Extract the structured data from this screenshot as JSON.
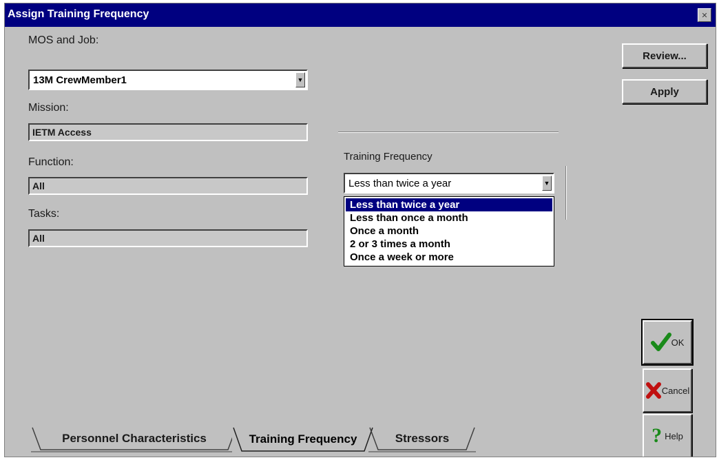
{
  "window": {
    "title": "Assign Training Frequency"
  },
  "mos_job": {
    "label": "MOS and Job:",
    "value": "13M CrewMember1"
  },
  "mission": {
    "label": "Mission:",
    "value": "IETM Access"
  },
  "function": {
    "label": "Function:",
    "value": "All"
  },
  "tasks": {
    "label": "Tasks:",
    "value": "All"
  },
  "training_frequency": {
    "label": "Training Frequency",
    "selected": "Less than twice a year",
    "options": [
      "Less than twice a year",
      "Less than once a month",
      "Once a month",
      "2 or 3 times a month",
      "Once a week or more"
    ]
  },
  "buttons": {
    "review": "Review...",
    "apply": "Apply",
    "ok": "OK",
    "cancel": "Cancel",
    "help": "Help"
  },
  "tabs": [
    "Personnel Characteristics",
    "Training Frequency",
    "Stressors"
  ],
  "colors": {
    "titlebar": "#000080",
    "face": "#c0c0c0",
    "selection": "#000080",
    "ok_check": "#1a8a1a",
    "cancel_x": "#c01010",
    "help_q": "#1a8a1a"
  },
  "icons": {
    "ok": "checkmark-icon",
    "cancel": "red-x-icon",
    "help": "question-mark-icon",
    "dropdown": "down-arrow-icon"
  }
}
